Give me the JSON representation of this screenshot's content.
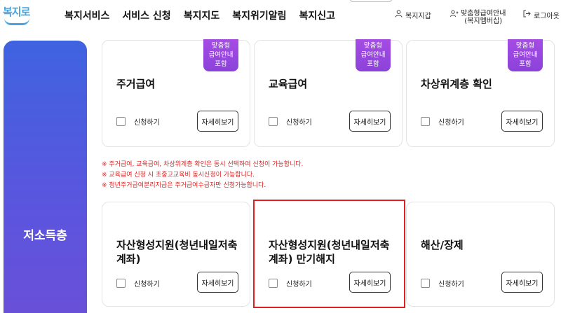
{
  "logo": {
    "text": "복지로"
  },
  "nav": {
    "items": [
      "복지서비스",
      "서비스 신청",
      "복지지도",
      "복지위기알림",
      "복지신고"
    ]
  },
  "util": {
    "wallet": "복지지갑",
    "custom_line1": "맞춤형급여안내",
    "custom_line2": "(복지멤버십)",
    "logout": "로그아웃"
  },
  "sidebar": {
    "title": "저소득층"
  },
  "badge": {
    "line1": "맞춤형",
    "line2": "급여안내",
    "line3": "포함"
  },
  "cards_row1": [
    {
      "title": "주거급여",
      "has_badge": true
    },
    {
      "title": "교육급여",
      "has_badge": true
    },
    {
      "title": "차상위계층 확인",
      "has_badge": true
    }
  ],
  "cards_row2": [
    {
      "title_line1": "자산형성지원(청년내일저축",
      "title_line2": "계좌)"
    },
    {
      "title_line1": "자산형성지원(청년내일저축",
      "title_line2": "계좌) 만기해지"
    },
    {
      "title_line1": "해산/장제",
      "title_line2": ""
    }
  ],
  "buttons": {
    "apply": "신청하기",
    "detail": "자세히보기"
  },
  "notes": [
    "※ 주거급여, 교육급여, 차상위계층 확인은 동시 선택하여 신청이 가능합니다.",
    "※ 교육급여 신청 시 초중고교육비 동시신청이 가능합니다.",
    "※ 청년주거급여분리지급은 주거급여수급자만 신청가능합니다."
  ],
  "colors": {
    "accent": "#5b55de",
    "badge": "#9b47e0",
    "warning": "#e02020",
    "highlight": "#e02020"
  },
  "icons": {
    "wallet": "person-icon",
    "custom": "people-icon",
    "logout": "logout-icon"
  }
}
